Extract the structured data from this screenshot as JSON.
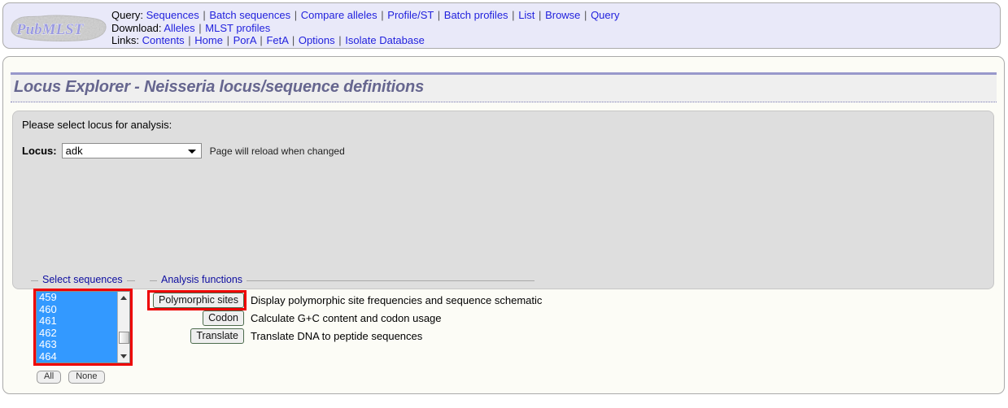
{
  "header": {
    "logo_text": "PubMLST",
    "nav_rows": [
      {
        "label": "Query:",
        "links": [
          "Sequences",
          "Batch sequences",
          "Compare alleles",
          "Profile/ST",
          "Batch profiles",
          "List",
          "Browse",
          "Query"
        ]
      },
      {
        "label": "Download:",
        "links": [
          "Alleles",
          "MLST profiles"
        ]
      },
      {
        "label": "Links:",
        "links": [
          "Contents",
          "Home",
          "PorA",
          "FetA",
          "Options",
          "Isolate Database"
        ]
      }
    ],
    "separator": "|"
  },
  "page": {
    "title": "Locus Explorer - Neisseria locus/sequence definitions"
  },
  "panel": {
    "intro": "Please select locus for analysis:",
    "locus_label": "Locus:",
    "locus_value": "adk",
    "locus_options": [
      "adk"
    ],
    "reload_note": "Page will reload when changed",
    "sequences_legend": "Select sequences",
    "analysis_legend": "Analysis functions",
    "sequence_options": [
      "459",
      "460",
      "461",
      "462",
      "463",
      "464"
    ],
    "select_all_label": "All",
    "select_none_label": "None",
    "functions": [
      {
        "button": "Polymorphic sites",
        "description": "Display polymorphic site frequencies and sequence schematic"
      },
      {
        "button": "Codon",
        "description": "Calculate G+C content and codon usage"
      },
      {
        "button": "Translate",
        "description": "Translate DNA to peptide sequences"
      }
    ]
  },
  "colors": {
    "header_bg": "#e9e9f9",
    "link": "#2222dd",
    "title_text": "#66668f",
    "title_rule": "#9898cb",
    "panel_bg": "#dedede",
    "legend_text": "#0e0ea0",
    "selection_blue": "#3399ff",
    "highlight_red": "#ee0000",
    "button_border_green": "#4c6b4c"
  }
}
